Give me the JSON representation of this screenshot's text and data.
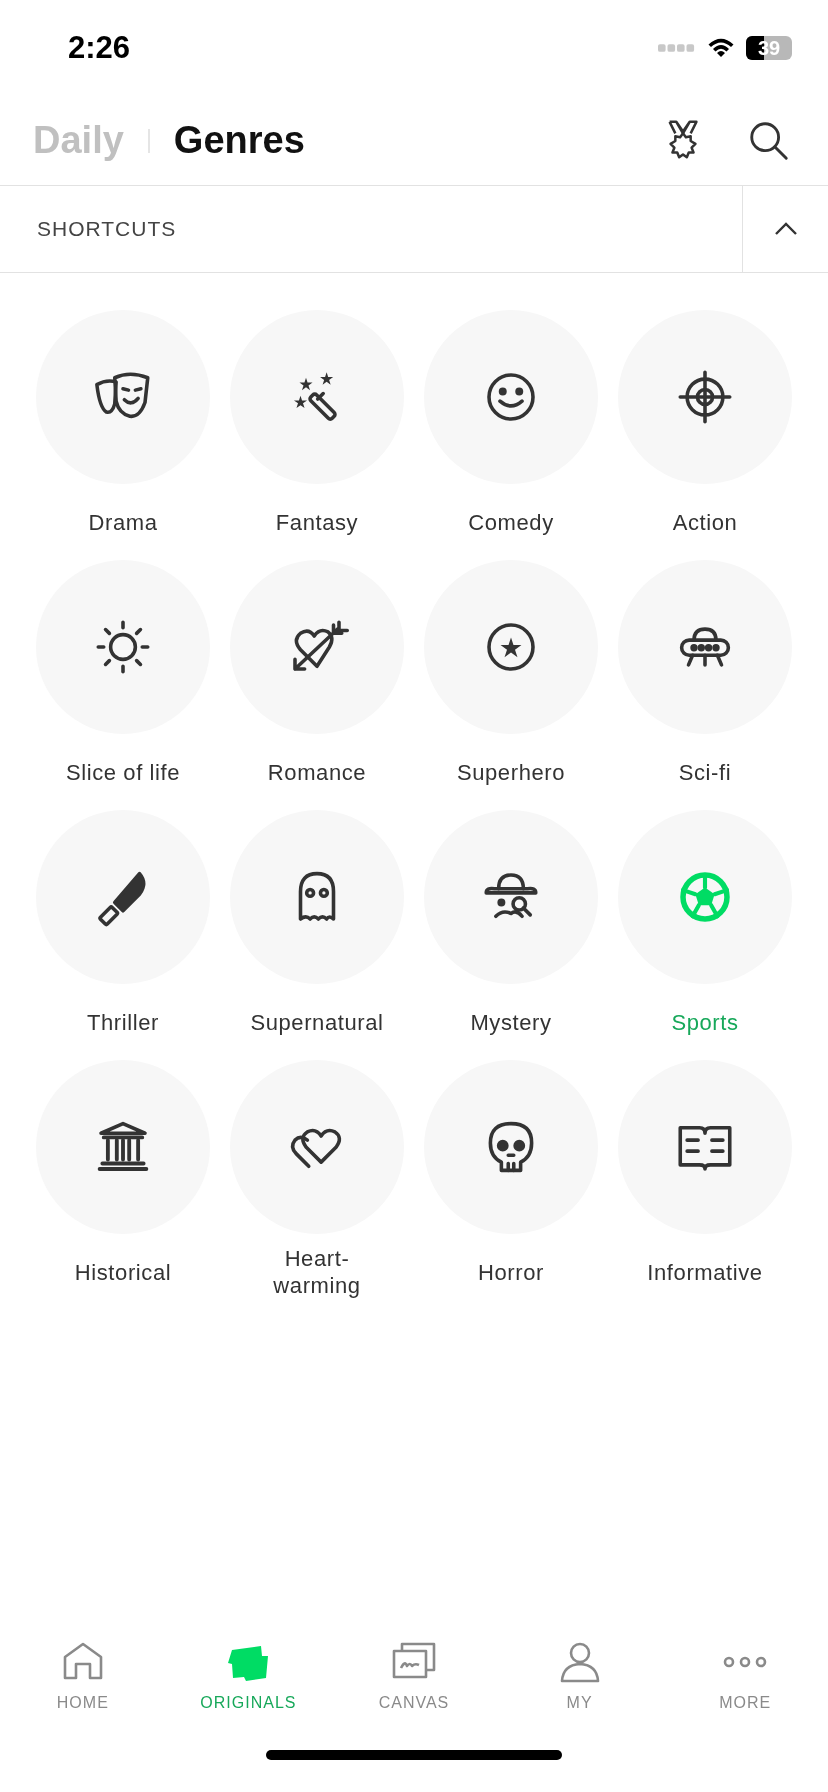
{
  "status_bar": {
    "time": "2:26",
    "battery": "39"
  },
  "header": {
    "tabs": [
      {
        "label": "Daily",
        "selected": false
      },
      {
        "label": "Genres",
        "selected": true
      }
    ]
  },
  "shortcuts": {
    "title": "SHORTCUTS",
    "expanded": true
  },
  "genres": [
    {
      "label": "Drama",
      "selected": false
    },
    {
      "label": "Fantasy",
      "selected": false
    },
    {
      "label": "Comedy",
      "selected": false
    },
    {
      "label": "Action",
      "selected": false
    },
    {
      "label": "Slice of life",
      "selected": false
    },
    {
      "label": "Romance",
      "selected": false
    },
    {
      "label": "Superhero",
      "selected": false
    },
    {
      "label": "Sci-fi",
      "selected": false
    },
    {
      "label": "Thriller",
      "selected": false
    },
    {
      "label": "Supernatural",
      "selected": false
    },
    {
      "label": "Mystery",
      "selected": false
    },
    {
      "label": "Sports",
      "selected": true
    },
    {
      "label": "Historical",
      "selected": false
    },
    {
      "label": "Heart-\nwarming",
      "selected": false
    },
    {
      "label": "Horror",
      "selected": false
    },
    {
      "label": "Informative",
      "selected": false
    }
  ],
  "bottom_nav": [
    {
      "label": "HOME",
      "selected": false
    },
    {
      "label": "ORIGINALS",
      "selected": true
    },
    {
      "label": "CANVAS",
      "selected": false
    },
    {
      "label": "MY",
      "selected": false
    },
    {
      "label": "MORE",
      "selected": false
    }
  ]
}
